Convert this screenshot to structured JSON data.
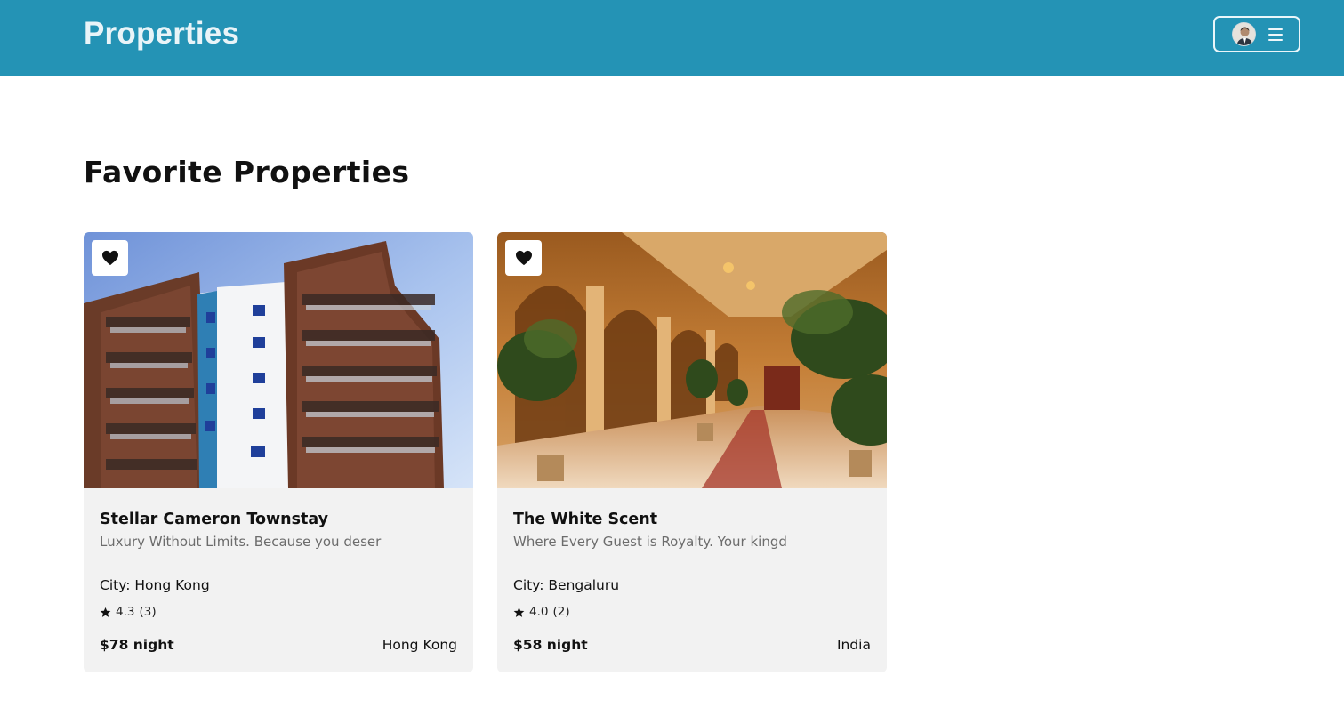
{
  "header": {
    "brand": "Properties",
    "user_menu": {
      "avatar_icon": "user-avatar",
      "menu_icon": "hamburger-icon"
    }
  },
  "page": {
    "title": "Favorite Properties"
  },
  "properties": [
    {
      "name": "Stellar Cameron Townstay",
      "description": "Luxury Without Limits. Because you deser",
      "city": "City: Hong Kong",
      "rating": "4.3",
      "reviews": "(3)",
      "price": "$78 night",
      "country": "Hong Kong",
      "favorite": true,
      "image": "apartment-building-photo"
    },
    {
      "name": "The White Scent",
      "description": "Where Every Guest is Royalty. Your kingd",
      "city": "City: Bengaluru",
      "rating": "4.0",
      "reviews": "(2)",
      "price": "$58 night",
      "country": "India",
      "favorite": true,
      "image": "palace-corridor-photo"
    }
  ],
  "colors": {
    "header_bg": "#2493b5",
    "card_bg": "#f2f2f2",
    "text": "#111111",
    "muted": "#6c6c6c"
  }
}
